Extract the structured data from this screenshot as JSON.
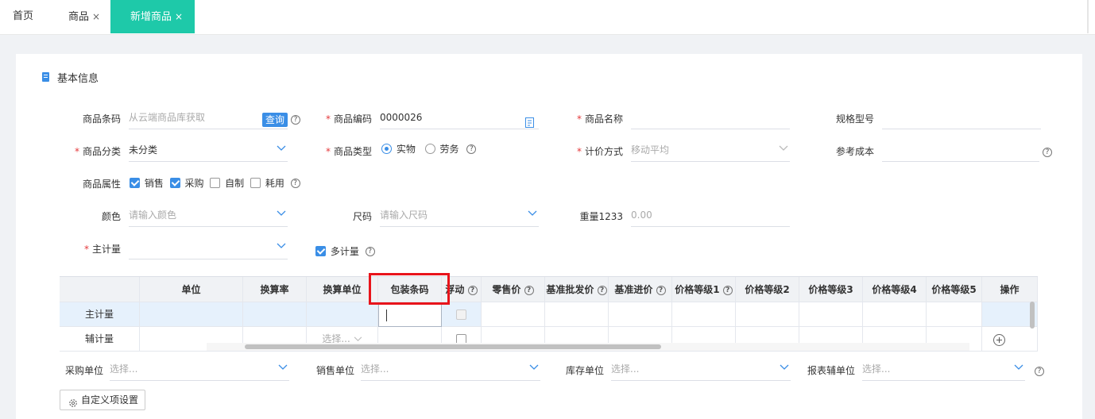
{
  "tabs": [
    {
      "label": "首页",
      "closable": false,
      "active": false
    },
    {
      "label": "商品",
      "closable": true,
      "active": false
    },
    {
      "label": "新增商品",
      "closable": true,
      "active": true
    }
  ],
  "close_glyph": "×",
  "accent_color": "#1ec9a9",
  "primary_color": "#3a8ee6",
  "section": {
    "title": "基本信息"
  },
  "form": {
    "barcode": {
      "label": "商品条码",
      "placeholder": "从云端商品库获取",
      "query_label": "查询"
    },
    "code": {
      "label": "商品编码",
      "value": "0000026"
    },
    "name": {
      "label": "商品名称",
      "value": ""
    },
    "spec": {
      "label": "规格型号",
      "value": ""
    },
    "category": {
      "label": "商品分类",
      "value": "未分类"
    },
    "type": {
      "label": "商品类型",
      "options": [
        "实物",
        "劳务"
      ],
      "selected": "实物"
    },
    "valuation": {
      "label": "计价方式",
      "value": "移动平均"
    },
    "ref_cost": {
      "label": "参考成本",
      "value": ""
    },
    "attributes": {
      "label": "商品属性",
      "options": [
        {
          "label": "销售",
          "checked": true
        },
        {
          "label": "采购",
          "checked": true
        },
        {
          "label": "自制",
          "checked": false
        },
        {
          "label": "耗用",
          "checked": false
        }
      ]
    },
    "color": {
      "label": "颜色",
      "placeholder": "请输入颜色"
    },
    "size": {
      "label": "尺码",
      "placeholder": "请输入尺码"
    },
    "weight": {
      "label": "重量1233",
      "placeholder": "0.00"
    },
    "main_unit": {
      "label": "主计量",
      "value": ""
    },
    "multi_unit": {
      "label": "多计量",
      "checked": true
    }
  },
  "grid": {
    "headers": [
      "",
      "单位",
      "换算率",
      "换算单位",
      "包装条码",
      "浮动",
      "零售价",
      "基准批发价",
      "基准进价",
      "价格等级1",
      "价格等级2",
      "价格等级3",
      "价格等级4",
      "价格等级5",
      "操作"
    ],
    "rows": [
      {
        "label": "主计量"
      },
      {
        "label": "辅计量",
        "conv_unit_placeholder": "选择..."
      }
    ]
  },
  "units": {
    "purchase": {
      "label": "采购单位",
      "placeholder": "选择..."
    },
    "sales": {
      "label": "销售单位",
      "placeholder": "选择..."
    },
    "stock": {
      "label": "库存单位",
      "placeholder": "选择..."
    },
    "report": {
      "label": "报表辅单位",
      "placeholder": "选择..."
    }
  },
  "custom_button": {
    "label": "自定义项设置"
  },
  "help_glyph": "?",
  "required_glyph": "*"
}
